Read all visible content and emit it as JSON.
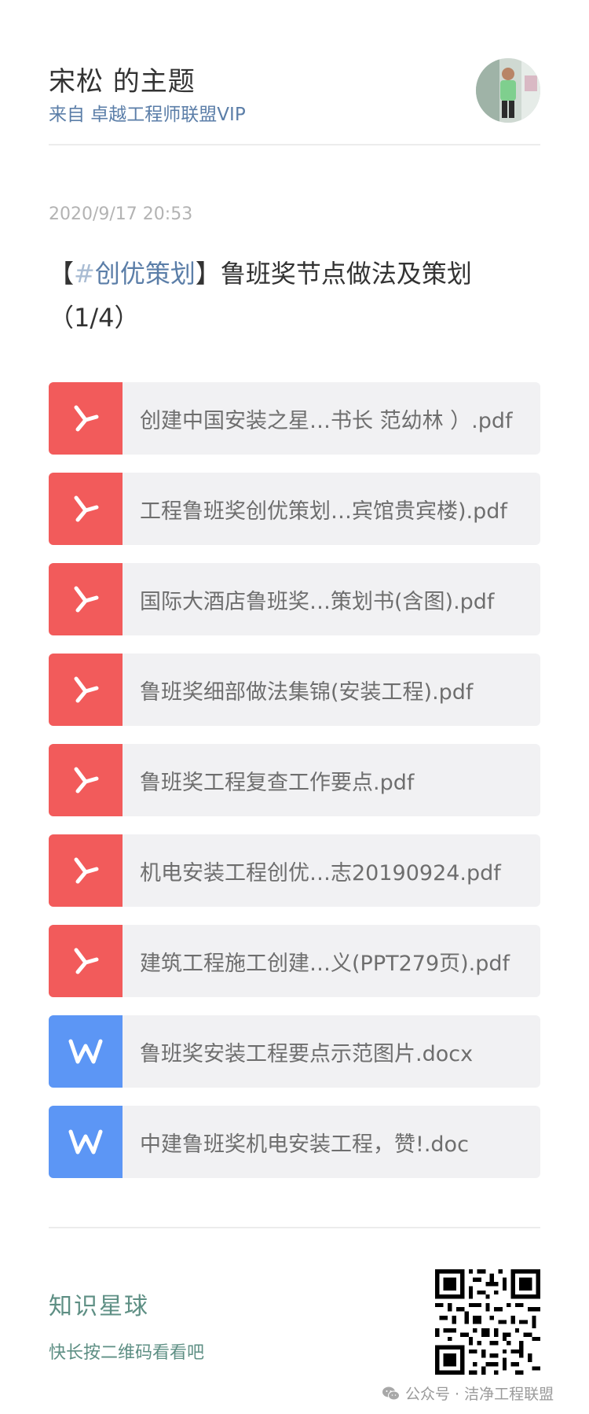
{
  "header": {
    "author_title": "宋松 的主题",
    "source": "来自 卓越工程师联盟VIP"
  },
  "post": {
    "timestamp": "2020/9/17 20:53",
    "title_open": "【",
    "hashtag_symbol": "#",
    "hashtag": "创优策划",
    "title_close": "】鲁班奖节点做法及策划",
    "title_part": "（1/4）"
  },
  "files": [
    {
      "name": "创建中国安装之星…书长 范幼林 ）.pdf",
      "type": "pdf"
    },
    {
      "name": "工程鲁班奖创优策划…宾馆贵宾楼).pdf",
      "type": "pdf"
    },
    {
      "name": "国际大酒店鲁班奖…策划书(含图).pdf",
      "type": "pdf"
    },
    {
      "name": "鲁班奖细部做法集锦(安装工程).pdf",
      "type": "pdf"
    },
    {
      "name": "鲁班奖工程复查工作要点.pdf",
      "type": "pdf"
    },
    {
      "name": "机电安装工程创优…志20190924.pdf",
      "type": "pdf"
    },
    {
      "name": "建筑工程施工创建…义(PPT279页).pdf",
      "type": "pdf"
    },
    {
      "name": "鲁班奖安装工程要点示范图片.docx",
      "type": "word"
    },
    {
      "name": "中建鲁班奖机电安装工程，赞!.doc",
      "type": "word"
    }
  ],
  "footer": {
    "planet_label": "知识星球",
    "planet_hint": "快长按二维码看看吧",
    "watermark": "公众号 · 洁净工程联盟"
  },
  "colors": {
    "pdf_icon": "#f25b5b",
    "word_icon": "#5c96f5",
    "link_blue": "#5b7ea8",
    "planet_green": "#5e8f84"
  },
  "icons": {
    "pdf": "pdf-icon",
    "word": "word-icon",
    "wechat": "wechat-icon",
    "qr": "qr-code"
  }
}
